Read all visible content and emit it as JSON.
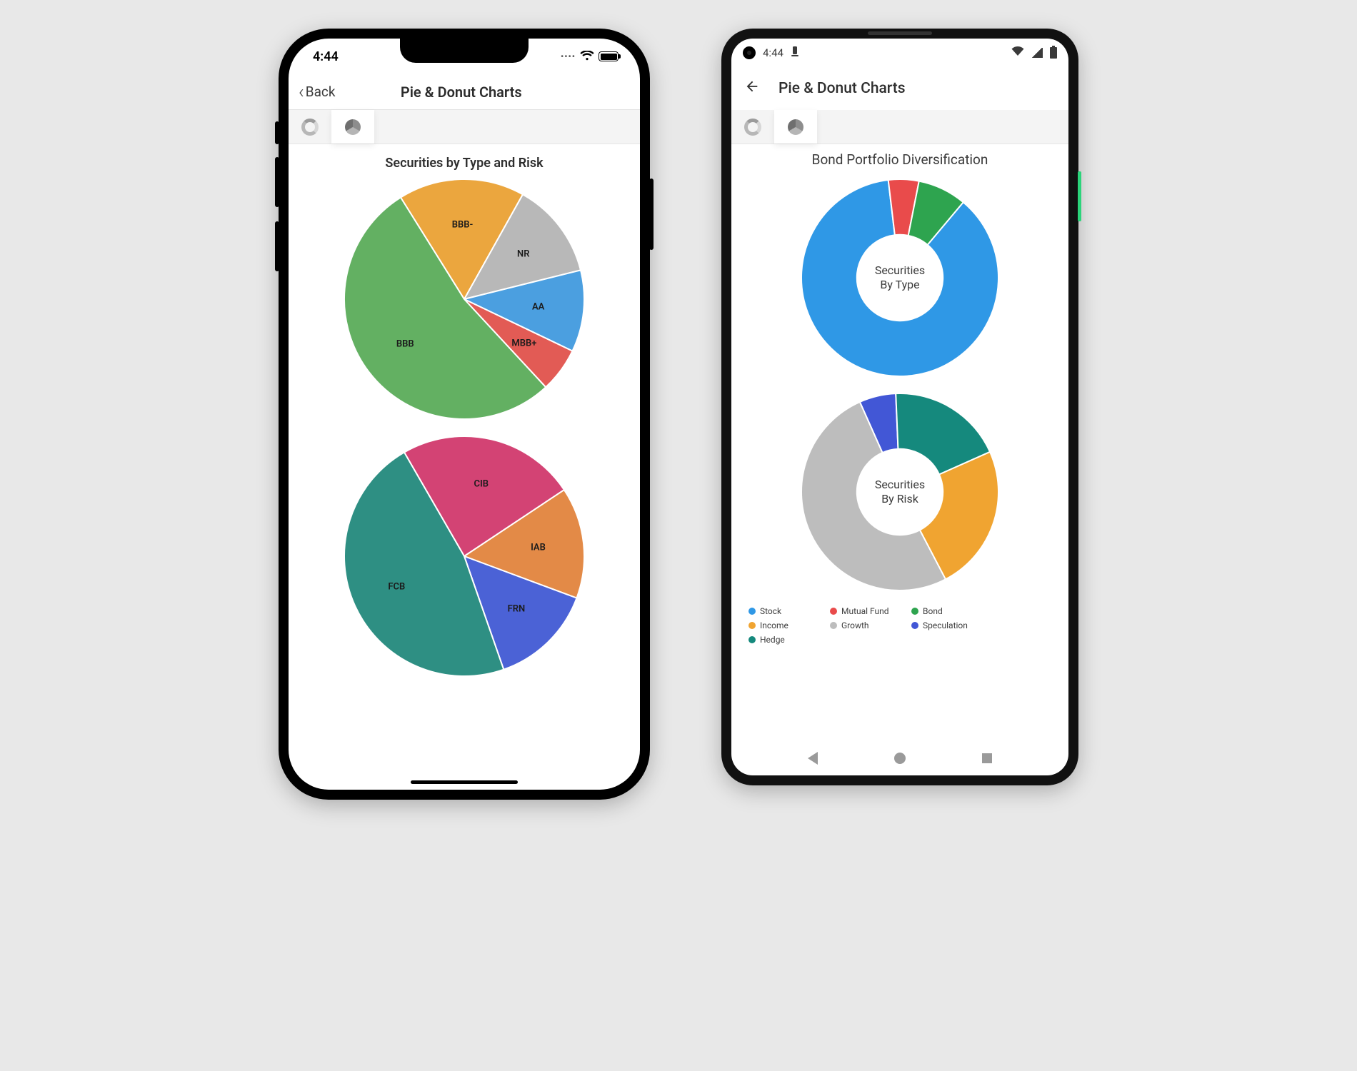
{
  "ios": {
    "status_time": "4:44",
    "back_label": "Back",
    "nav_title": "Pie & Donut Charts",
    "section_title": "Securities by Type and Risk"
  },
  "android": {
    "status_time": "4:44",
    "nav_title": "Pie & Donut Charts",
    "section_title": "Bond Portfolio Diversification",
    "donut1_line1": "Securities",
    "donut1_line2": "By Type",
    "donut2_line1": "Securities",
    "donut2_line2": "By Risk"
  },
  "legend": [
    {
      "label": "Stock",
      "color": "#2f98e6"
    },
    {
      "label": "Mutual Fund",
      "color": "#e94b4b"
    },
    {
      "label": "Bond",
      "color": "#2ea44f"
    },
    {
      "label": "Income",
      "color": "#f0a431"
    },
    {
      "label": "Growth",
      "color": "#bdbdbd"
    },
    {
      "label": "Speculation",
      "color": "#4257d6"
    },
    {
      "label": "Hedge",
      "color": "#15897d"
    }
  ],
  "chart_data": [
    {
      "id": "ios_pie_top",
      "type": "pie",
      "title": "Securities by Type and Risk — upper pie",
      "series": [
        {
          "name": "BBB-",
          "value": 17,
          "color": "#eba63e"
        },
        {
          "name": "NR",
          "value": 13,
          "color": "#b8b8b8"
        },
        {
          "name": "AA",
          "value": 11,
          "color": "#4b9fe0"
        },
        {
          "name": "MBB+",
          "value": 6,
          "color": "#e25b55"
        },
        {
          "name": "BBB",
          "value": 53,
          "color": "#63b062"
        }
      ]
    },
    {
      "id": "ios_pie_bottom",
      "type": "pie",
      "title": "Securities by Type and Risk — lower pie",
      "series": [
        {
          "name": "CIB",
          "value": 24,
          "color": "#d34374"
        },
        {
          "name": "IAB",
          "value": 15,
          "color": "#e38a47"
        },
        {
          "name": "FRN",
          "value": 14,
          "color": "#4b62d6"
        },
        {
          "name": "FCB",
          "value": 47,
          "color": "#2e8f83"
        }
      ]
    },
    {
      "id": "android_donut_type",
      "type": "pie",
      "title": "Securities By Type",
      "donut": true,
      "series": [
        {
          "name": "Stock",
          "value": 87,
          "color": "#2f98e6"
        },
        {
          "name": "Mutual Fund",
          "value": 5,
          "color": "#e94b4b"
        },
        {
          "name": "Bond",
          "value": 8,
          "color": "#2ea44f"
        }
      ]
    },
    {
      "id": "android_donut_risk",
      "type": "pie",
      "title": "Securities By Risk",
      "donut": true,
      "series": [
        {
          "name": "Speculation",
          "value": 6,
          "color": "#4257d6"
        },
        {
          "name": "Hedge",
          "value": 19,
          "color": "#15897d"
        },
        {
          "name": "Income",
          "value": 24,
          "color": "#f0a431"
        },
        {
          "name": "Growth",
          "value": 51,
          "color": "#bdbdbd"
        }
      ]
    }
  ]
}
